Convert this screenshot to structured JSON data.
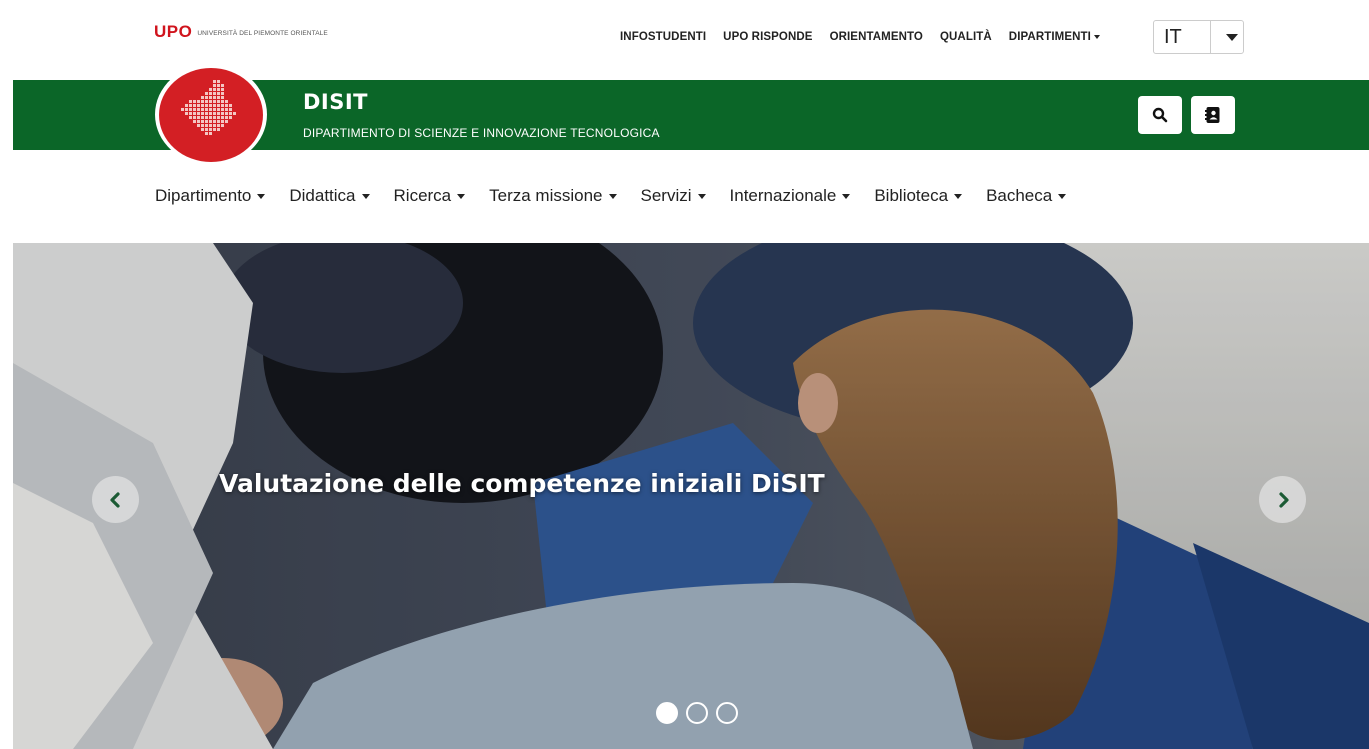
{
  "university": {
    "logo_mark": "UPO",
    "logo_text": "UNIVERSITÀ DEL PIEMONTE ORIENTALE"
  },
  "utility_nav": [
    {
      "label": "INFOSTUDENTI"
    },
    {
      "label": "UPO RISPONDE"
    },
    {
      "label": "ORIENTAMENTO"
    },
    {
      "label": "QUALITÀ"
    },
    {
      "label": "DIPARTIMENTI"
    }
  ],
  "language": {
    "value": "IT"
  },
  "department": {
    "name": "DISIT",
    "full_name": "DIPARTIMENTO DI SCIENZE E INNOVAZIONE TECNOLOGICA"
  },
  "main_nav": [
    {
      "label": "Dipartimento"
    },
    {
      "label": "Didattica"
    },
    {
      "label": "Ricerca"
    },
    {
      "label": "Terza missione"
    },
    {
      "label": "Servizi"
    },
    {
      "label": "Internazionale"
    },
    {
      "label": "Biblioteca"
    },
    {
      "label": "Bacheca"
    }
  ],
  "carousel": {
    "caption": "Valutazione delle competenze iniziali DiSIT",
    "slide_count": 3,
    "active_slide": 1
  },
  "colors": {
    "brand_green": "#0b6628",
    "brand_red": "#d31f24",
    "upo_red": "#d0141d"
  },
  "icons": {
    "search": "search-icon",
    "contacts": "address-book-icon",
    "prev": "chevron-left-icon",
    "next": "chevron-right-icon"
  }
}
